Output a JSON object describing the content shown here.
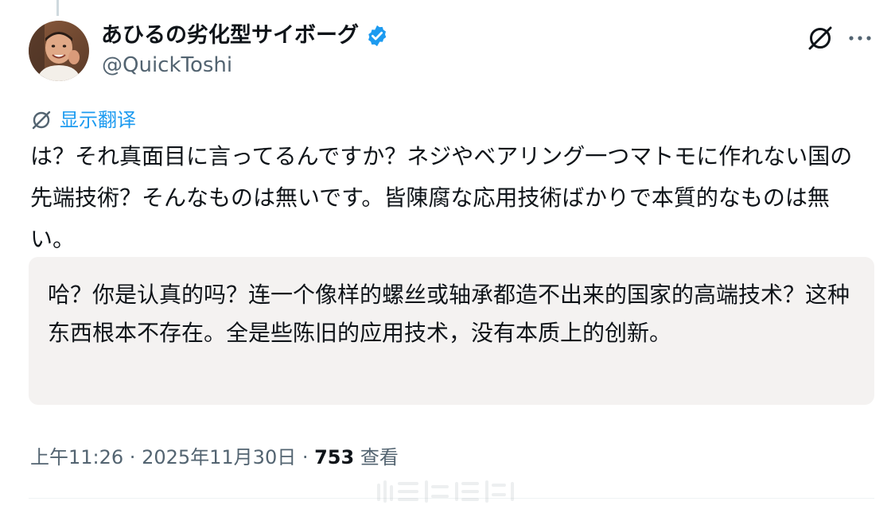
{
  "author": {
    "display_name": "あひるの劣化型サイボーグ",
    "handle": "@QuickToshi",
    "verified_color": "#1d9bf0"
  },
  "icons": {
    "verified": "verified-badge-icon",
    "translate": "translate-slash-icon",
    "more": "more-dots-icon"
  },
  "translate_link": {
    "label": "显示翻译"
  },
  "tweet": {
    "text": "は？それ真面目に言ってるんですか？ネジやベアリング一つマトモに作れない国の先端技術？そんなものは無いです。皆陳腐な応用技術ばかりで本質的なものは無い。",
    "translation": "哈？你是认真的吗？连一个像样的螺丝或轴承都造不出来的国家的高端技术？这种东西根本不存在。全是些陈旧的应用技术，没有本质上的创新。"
  },
  "meta": {
    "time": "上午11:26",
    "sep1": " · ",
    "date": "2025年11月30日",
    "sep2": " · ",
    "views_count": "753",
    "views_label": " 查看"
  },
  "colors": {
    "accent": "#1d9bf0",
    "secondary_text": "#536471",
    "translation_bg": "#f4f2f1"
  }
}
